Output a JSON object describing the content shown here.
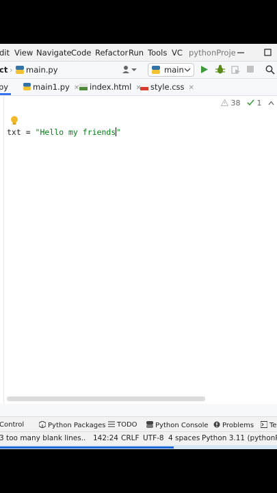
{
  "menu": {
    "items": [
      "dit",
      "View",
      "Navigate",
      "Code",
      "Refactor",
      "Run",
      "Tools",
      "VC"
    ],
    "project": "pythonProje"
  },
  "navbar": {
    "project_crumb": "ct",
    "file_crumb": "main.py",
    "run_config": "main"
  },
  "tabs": [
    {
      "label": "py"
    },
    {
      "label": "main1.py"
    },
    {
      "label": "index.html"
    },
    {
      "label": "style.css"
    }
  ],
  "editor": {
    "code_var": "txt = ",
    "code_string": "\"Hello my friends",
    "code_after_caret": "\"",
    "warnings_count": "38",
    "weak_warnings_count": "1"
  },
  "toolwindows": [
    "Control",
    "Python Packages",
    "TODO",
    "Python Console",
    "Problems",
    "Te"
  ],
  "status": {
    "message": "3 too many blank lines..",
    "position": "142:24",
    "line_ending": "CRLF",
    "encoding": "UTF-8",
    "indent": "4 spaces",
    "interpreter": "Python 3.11 (pythonPro"
  },
  "colors": {
    "accent": "#1b6ad5",
    "run_green": "#3c9a3c",
    "debug_green": "#5a8a1a",
    "string_green": "#067d17"
  }
}
